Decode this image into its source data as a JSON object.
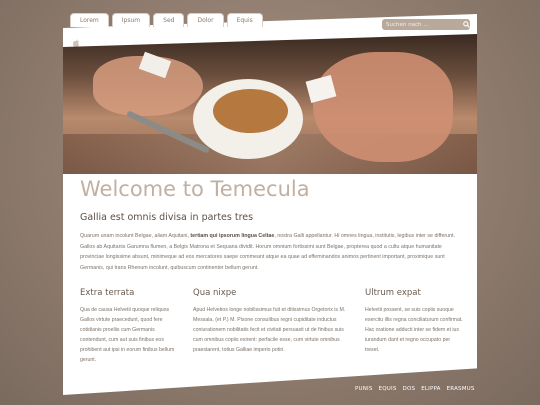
{
  "nav": {
    "tabs": [
      "Lorem",
      "Ipsum",
      "Sed",
      "Dolor",
      "Equis"
    ]
  },
  "search": {
    "placeholder": "Suchen nach ..."
  },
  "main": {
    "title": "Welcome to Temecula",
    "subtitle": "Gallia est omnis divisa in partes tres",
    "intro_before": "Quarum unam incolunt Belgae, aliam Aquitani, ",
    "intro_bold": "tertiam qui ipsorum lingua Celtae",
    "intro_after": ", nostra Galli appellantur. Hi omnes lingua, institutis, legibus inter se differunt. Gallos ab Aquitanis Garumna flumen, a Belgis Matrona et Sequana dividit. Horum omnium fortissimi sunt Belgae, propterea quod a cultu atque humanitate provinciae longissime absunt, minimeque ad eos mercatores saepe commeant atque ea quae ad effeminandos animos pertinent important, proximique sunt Germanis, qui trans Rhenum incolunt, quibuscum continenter bellum gerunt."
  },
  "columns": [
    {
      "heading": "Extra terrata",
      "text": "Qua de causa Helvetii quoque reliquos Gallos virtute praecedunt, quod fere cotidianis proeliis cum Germanis contendunt, cum aut suis finibus eos prohibent aut ipsi in eorum finibus bellum gerunt."
    },
    {
      "heading": "Qua nixpe",
      "text": "Apud Helvetios longe nobilissimus fuit et ditissimus Orgetorix is M. Messala, (et P.) M. Pisone consulibus regni cupiditate inductus coniurationem nobilitatis fecit et civitati persuasit ut de finibus suis cum omnibus copiis exirent: perfacile esse, cum virtute omnibus praestarent, totius Galliae imperio potiri."
    },
    {
      "heading": "Ultrum expat",
      "text": "Helvetii possent, se suis copiis suoque exercitu illis regna conciliaturum confirmat. Hac oratione adducti inter se fidem et ius iurandum dant et regno occupato per treset."
    }
  ],
  "footer": {
    "links": [
      "PUNIS",
      "EQUIS",
      "DOS",
      "ELIPPA",
      "ERASMUS"
    ]
  }
}
